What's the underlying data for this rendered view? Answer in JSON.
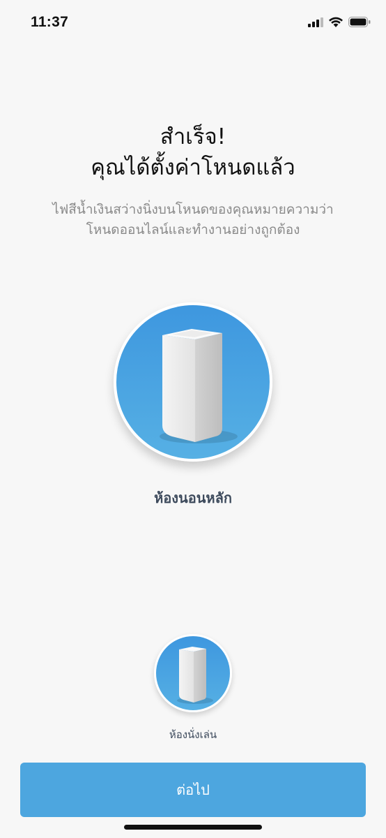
{
  "status_bar": {
    "time": "11:37",
    "icons": [
      "cellular-signal-icon",
      "wifi-icon",
      "battery-icon"
    ]
  },
  "header": {
    "title_line1": "สำเร็จ!",
    "title_line2": "คุณได้ตั้งค่าโหนดแล้ว",
    "subtitle_line1": "ไฟสีน้ำเงินสว่างนิ่งบนโหนดของคุณหมายความว่า",
    "subtitle_line2": "โหนดออนไลน์และทำงานอย่างถูกต้อง"
  },
  "nodes": [
    {
      "label": "ห้องนอนหลัก",
      "icon": "velop-node-icon"
    },
    {
      "label": "ห้องนั่งเล่น",
      "icon": "velop-node-icon"
    }
  ],
  "footer": {
    "next_label": "ต่อไป"
  },
  "colors": {
    "accent": "#4da6df",
    "circle_top": "#3e97df",
    "circle_bottom": "#56b0e4",
    "label_text": "#3d4a5c",
    "subtitle_text": "#8a8a8a"
  }
}
